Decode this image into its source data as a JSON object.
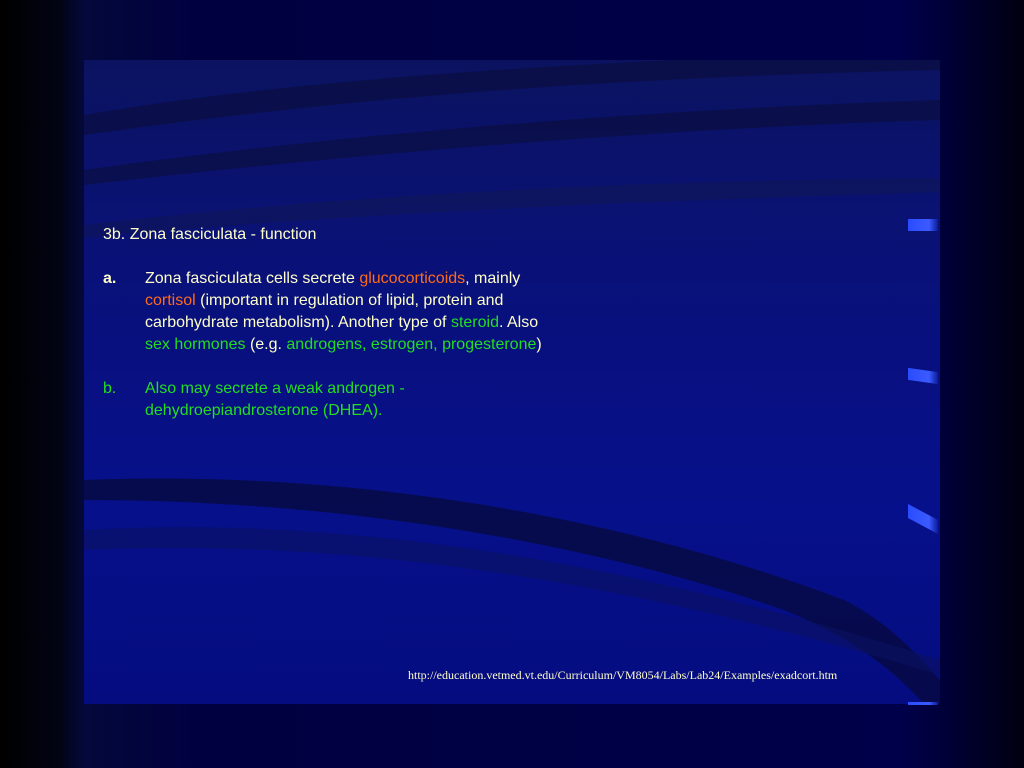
{
  "slide": {
    "heading": "3b. Zona fasciculata - function",
    "item_a": {
      "marker": "a.",
      "t1": "Zona fasciculata cells secrete ",
      "k1": "glucocorticoids",
      "t2": ", mainly ",
      "k2": "cortisol",
      "t3": " (important in regulation of lipid, protein and carbohydrate metabolism). Another type of ",
      "k3": "steroid",
      "t4": ". Also ",
      "k4": "sex hormones",
      "t5": " (e.g. ",
      "k5": "androgens, estrogen, progesterone",
      "t6": ")"
    },
    "item_b": {
      "marker": "b.",
      "text": "Also may secrete a weak androgen - dehydroepiandrosterone (DHEA)."
    },
    "source_url": "http://education.vetmed.vt.edu/Curriculum/VM8054/Labs/Lab24/Examples/exadcort.htm"
  },
  "colors": {
    "text": "#ffffcc",
    "highlight_orange": "#ff6a1a",
    "highlight_green": "#22dd22",
    "background": "#000060"
  }
}
